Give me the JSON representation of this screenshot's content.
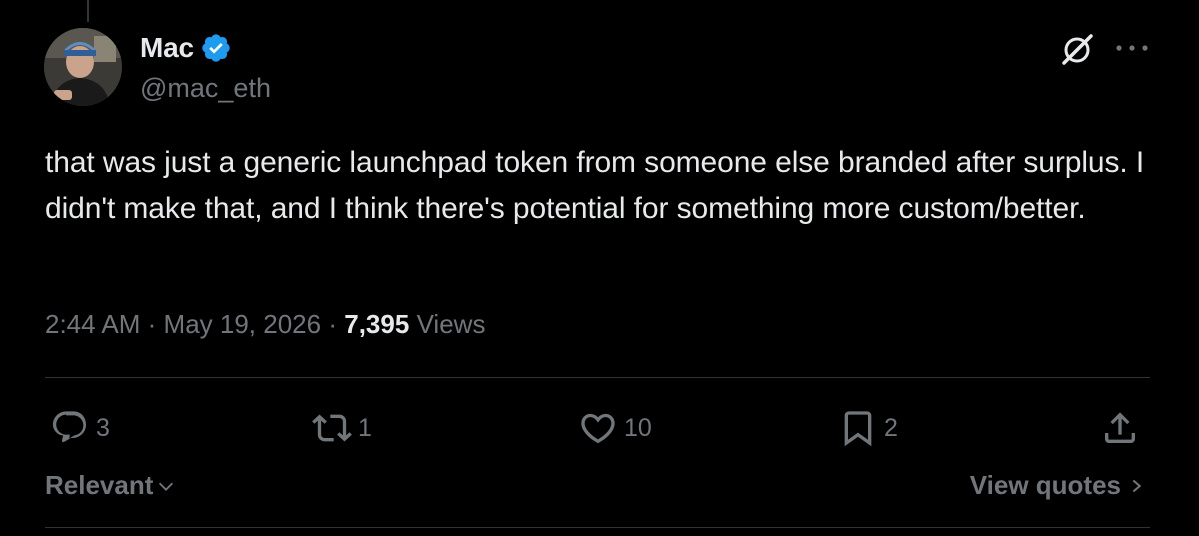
{
  "author": {
    "name": "Mac",
    "handle": "@mac_eth",
    "verified": true
  },
  "tweet": {
    "text": "that was just a generic launchpad token from someone else branded after surplus. I didn't make that, and I think there's potential for something more custom/better.",
    "time": "2:44 AM",
    "date": "May 19, 2026",
    "views_count": "7,395",
    "views_label": "Views",
    "separator": "·"
  },
  "actions": {
    "replies": "3",
    "retweets": "1",
    "likes": "10",
    "bookmarks": "2"
  },
  "footer": {
    "sort_label": "Relevant",
    "view_quotes_label": "View quotes"
  },
  "icons": {
    "verified": "verified-badge-icon",
    "grok": "grok-icon",
    "more": "more-icon",
    "reply": "reply-icon",
    "retweet": "retweet-icon",
    "like": "heart-icon",
    "bookmark": "bookmark-icon",
    "share": "share-icon"
  },
  "colors": {
    "background": "#000000",
    "text": "#e7e9ea",
    "secondary": "#71767b",
    "divider": "#2f3336",
    "verified": "#1d9bf0"
  }
}
